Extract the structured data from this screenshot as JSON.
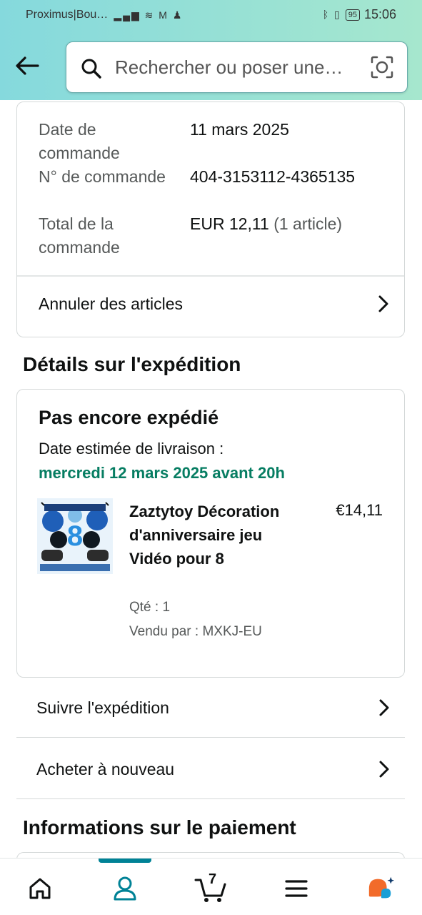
{
  "status_bar": {
    "carrier": "Proximus|Bou…",
    "battery": "95",
    "time": "15:06"
  },
  "search": {
    "placeholder": "Rechercher ou poser une…"
  },
  "order": {
    "rows": [
      {
        "label": "Date de commande",
        "value": "11 mars 2025"
      },
      {
        "label": "N° de commande",
        "value": "404-3153112-4365135"
      },
      {
        "label": "Total de la commande",
        "value": "EUR 12,11",
        "extra": "(1 article)"
      }
    ],
    "cancel_label": "Annuler des articles"
  },
  "shipping": {
    "section_title": "Détails sur l'expédition",
    "status": "Pas encore expédié",
    "estimate_label": "Date estimée de livraison :",
    "estimate_date": "mercredi 12 mars 2025 avant 20h",
    "product": {
      "title": "Zaztytoy Décoration d'anniversaire jeu Vidéo pour 8",
      "price": "€14,11",
      "qty": "Qté : 1",
      "seller": "Vendu par : MXKJ-EU"
    },
    "track_label": "Suivre l'expédition",
    "buy_again_label": "Acheter à nouveau"
  },
  "payment": {
    "section_title": "Informations sur le paiement"
  },
  "bottom_nav": {
    "cart_count": "7",
    "items": [
      "home-icon",
      "account-icon",
      "cart-icon",
      "menu-icon",
      "rufus-icon"
    ]
  },
  "colors": {
    "header_gradient_start": "#85d9dd",
    "header_gradient_end": "#a6e7ce",
    "delivery_green": "#067d62",
    "active_tab": "#008296"
  }
}
